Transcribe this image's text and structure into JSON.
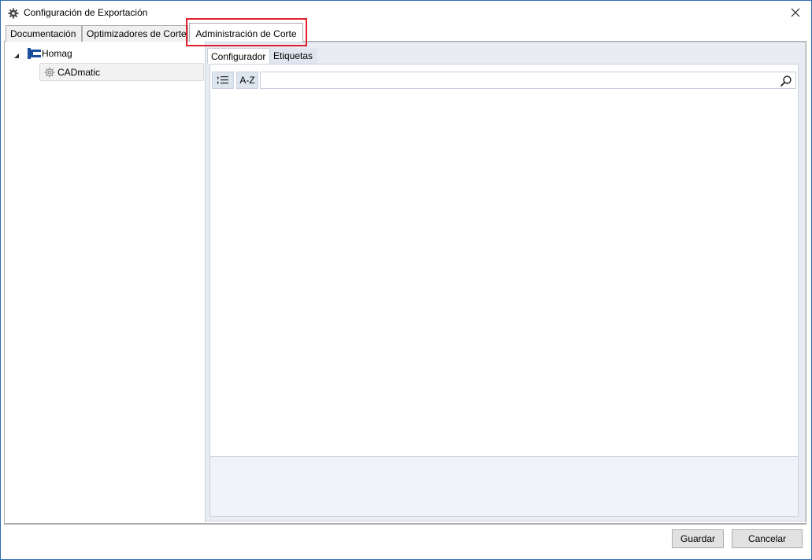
{
  "window": {
    "title": "Configuración de Exportación"
  },
  "top_tabs": [
    {
      "label": "Documentación"
    },
    {
      "label": "Optimizadores de Corte"
    },
    {
      "label": "Administración de Corte",
      "active": true
    }
  ],
  "tree": {
    "root": {
      "label": "Homag",
      "icon": "homag-logo-icon",
      "expanded": true
    },
    "child": {
      "label": "CADmatic",
      "icon": "gear-icon",
      "selected": true
    }
  },
  "inner_tabs": [
    {
      "label": "Configurador",
      "active": true
    },
    {
      "label": "Etiquetas"
    }
  ],
  "toolbar": {
    "categorized_icon": "categorized-list-icon",
    "alphabetical_label": "A-Z",
    "search_value": "",
    "search_icon": "search-icon"
  },
  "footer": {
    "save_label": "Guardar",
    "cancel_label": "Cancelar"
  },
  "colors": {
    "highlight": "#e0202a",
    "panel_bg": "#e9edf3",
    "homag_blue": "#1b4f9c"
  }
}
